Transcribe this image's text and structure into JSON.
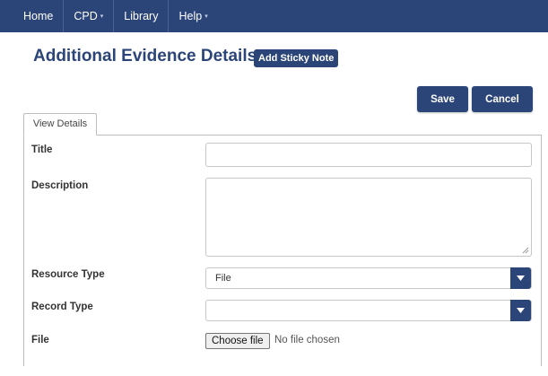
{
  "nav": {
    "items": [
      {
        "label": "Home",
        "has_dropdown": false
      },
      {
        "label": "CPD",
        "has_dropdown": true
      },
      {
        "label": "Library",
        "has_dropdown": false
      },
      {
        "label": "Help",
        "has_dropdown": true
      }
    ]
  },
  "header": {
    "title": "Additional Evidence Details",
    "sticky_note_label": "Add Sticky Note"
  },
  "actions": {
    "save_label": "Save",
    "cancel_label": "Cancel"
  },
  "tabs": [
    {
      "label": "View Details",
      "active": true
    }
  ],
  "form": {
    "title_label": "Title",
    "title_value": "",
    "description_label": "Description",
    "description_value": "",
    "resource_type_label": "Resource Type",
    "resource_type_value": "File",
    "record_type_label": "Record Type",
    "record_type_value": "",
    "file_label": "File",
    "file_button_label": "Choose file",
    "file_status": "No file chosen"
  },
  "colors": {
    "brand": "#2c4578"
  }
}
